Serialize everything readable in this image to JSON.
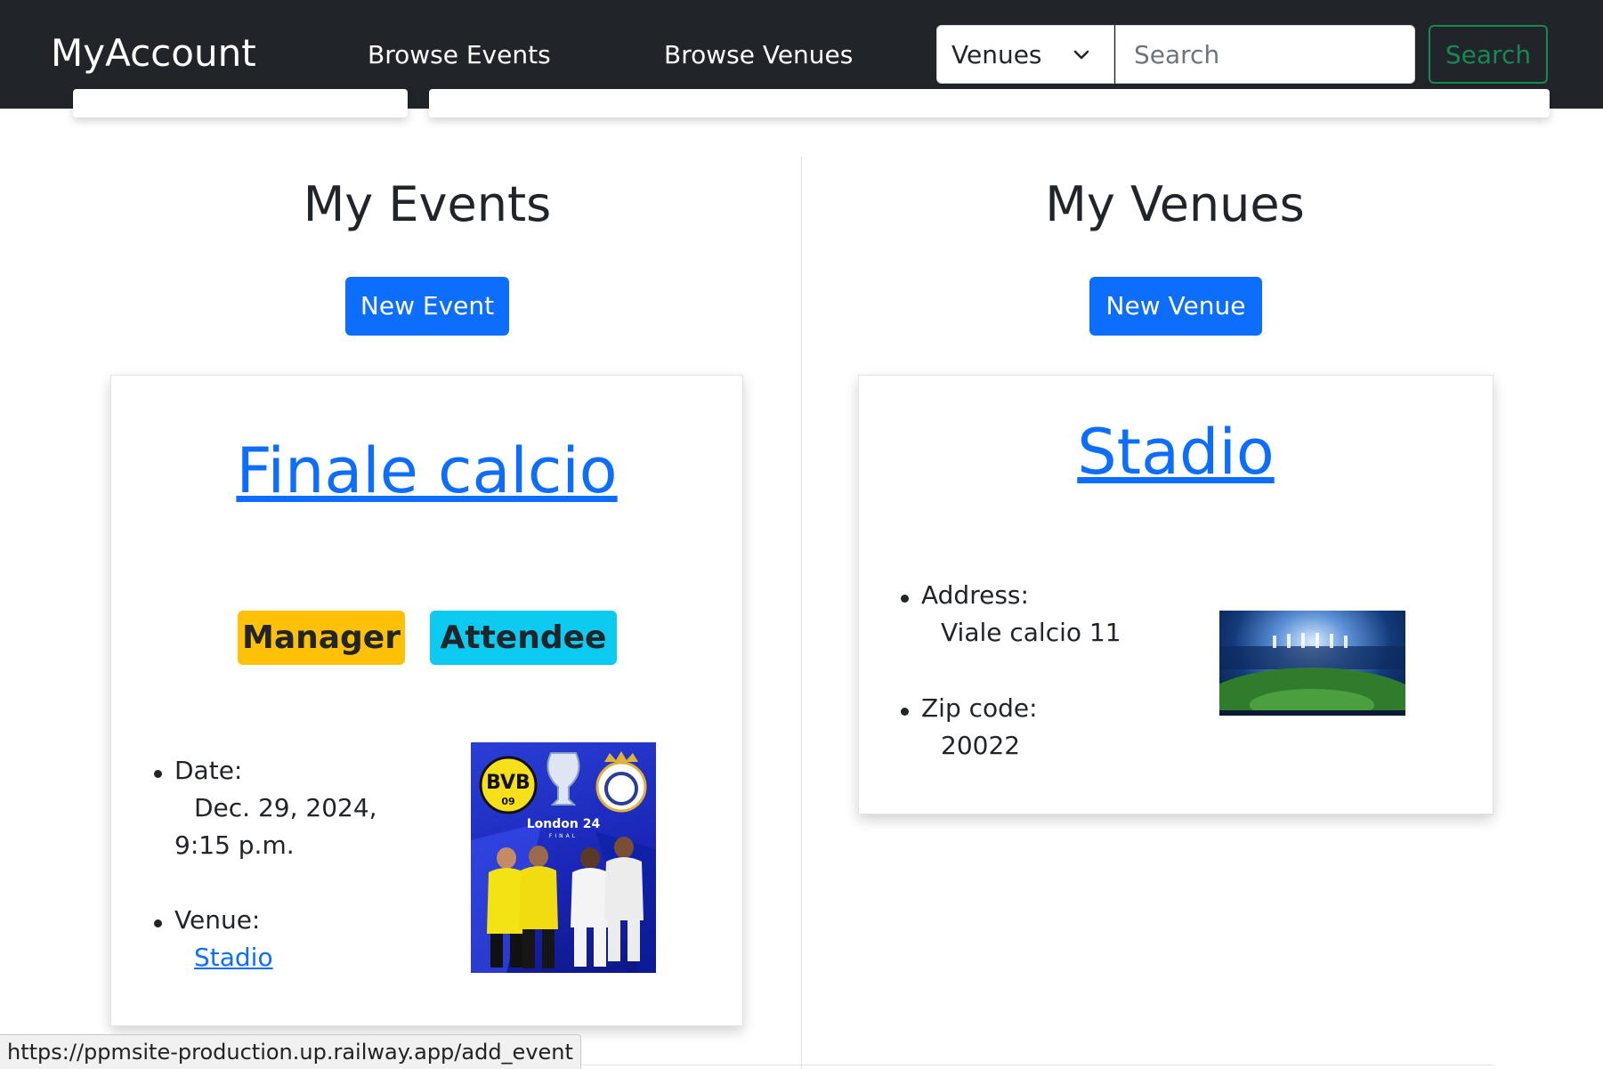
{
  "navbar": {
    "brand": "MyAccount",
    "links": [
      "Browse Events",
      "Browse Venues"
    ],
    "search_type": "Venues",
    "search_placeholder": "Search",
    "search_button": "Search"
  },
  "events": {
    "title": "My Events",
    "new_button": "New Event",
    "card": {
      "name": "Finale calcio",
      "badges": [
        "Manager",
        "Attendee"
      ],
      "date_label": "Date:",
      "date_value_1": "Dec. 29, 2024,",
      "date_value_2": "9:15 p.m.",
      "venue_label": "Venue:",
      "venue_link": "Stadio",
      "poster_text": "London 24",
      "poster_subtext": "FINAL",
      "poster_logo_left": "BVB",
      "poster_logo_left_sub": "09"
    }
  },
  "venues": {
    "title": "My Venues",
    "new_button": "New Venue",
    "card": {
      "name": "Stadio",
      "address_label": "Address:",
      "address_value": "Viale calcio 11",
      "zip_label": "Zip code:",
      "zip_value": "20022"
    }
  },
  "status_url": "https://ppmsite-production.up.railway.app/add_event",
  "colors": {
    "navbar_bg": "#212529",
    "primary": "#0d6efd",
    "success": "#198754",
    "warning": "#ffc107",
    "info": "#0dcaf0"
  }
}
